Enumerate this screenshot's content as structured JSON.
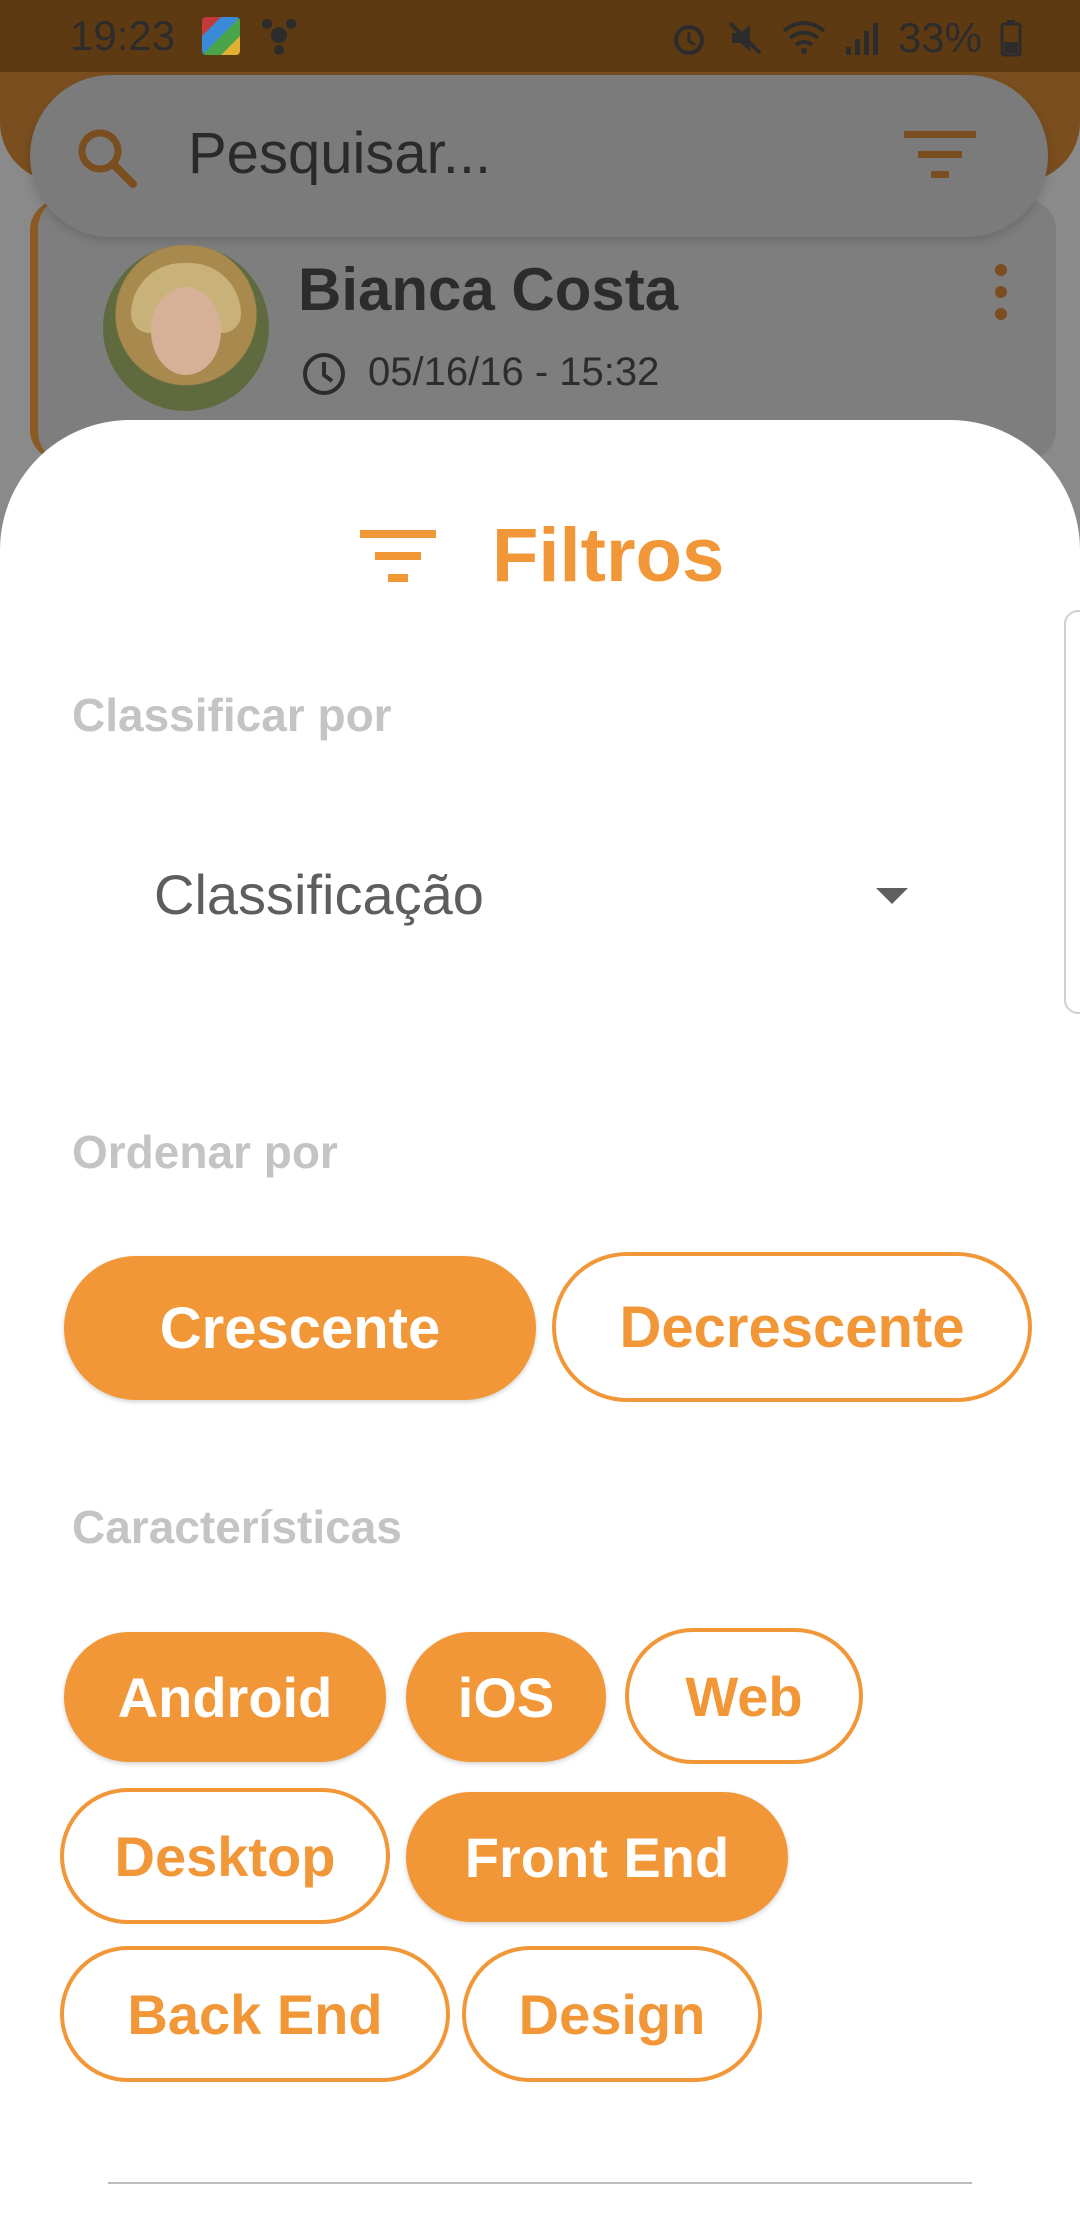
{
  "status_bar": {
    "time": "19:23",
    "battery": "33%",
    "icons": [
      "app-icon",
      "bug-icon",
      "alarm-icon",
      "mute-icon",
      "wifi-icon",
      "signal-icon",
      "battery-icon"
    ]
  },
  "search": {
    "placeholder": "Pesquisar..."
  },
  "card": {
    "name": "Bianca Costa",
    "datetime": "05/16/16 - 15:32"
  },
  "filters": {
    "title": "Filtros",
    "sort_label": "Classificar por",
    "sort_value": "Classificação",
    "order_label": "Ordenar por",
    "order_options": [
      {
        "label": "Crescente",
        "selected": true
      },
      {
        "label": "Decrescente",
        "selected": false
      }
    ],
    "features_label": "Características",
    "features": [
      {
        "label": "Android",
        "selected": true
      },
      {
        "label": "iOS",
        "selected": true
      },
      {
        "label": "Web",
        "selected": false
      },
      {
        "label": "Desktop",
        "selected": false
      },
      {
        "label": "Front End",
        "selected": true
      },
      {
        "label": "Back End",
        "selected": false
      },
      {
        "label": "Design",
        "selected": false
      }
    ]
  },
  "colors": {
    "accent": "#f29738",
    "label_gray": "#c4c4c4",
    "overlay_gray": "#7b7b7b",
    "status_bar": "#5e3a12"
  }
}
